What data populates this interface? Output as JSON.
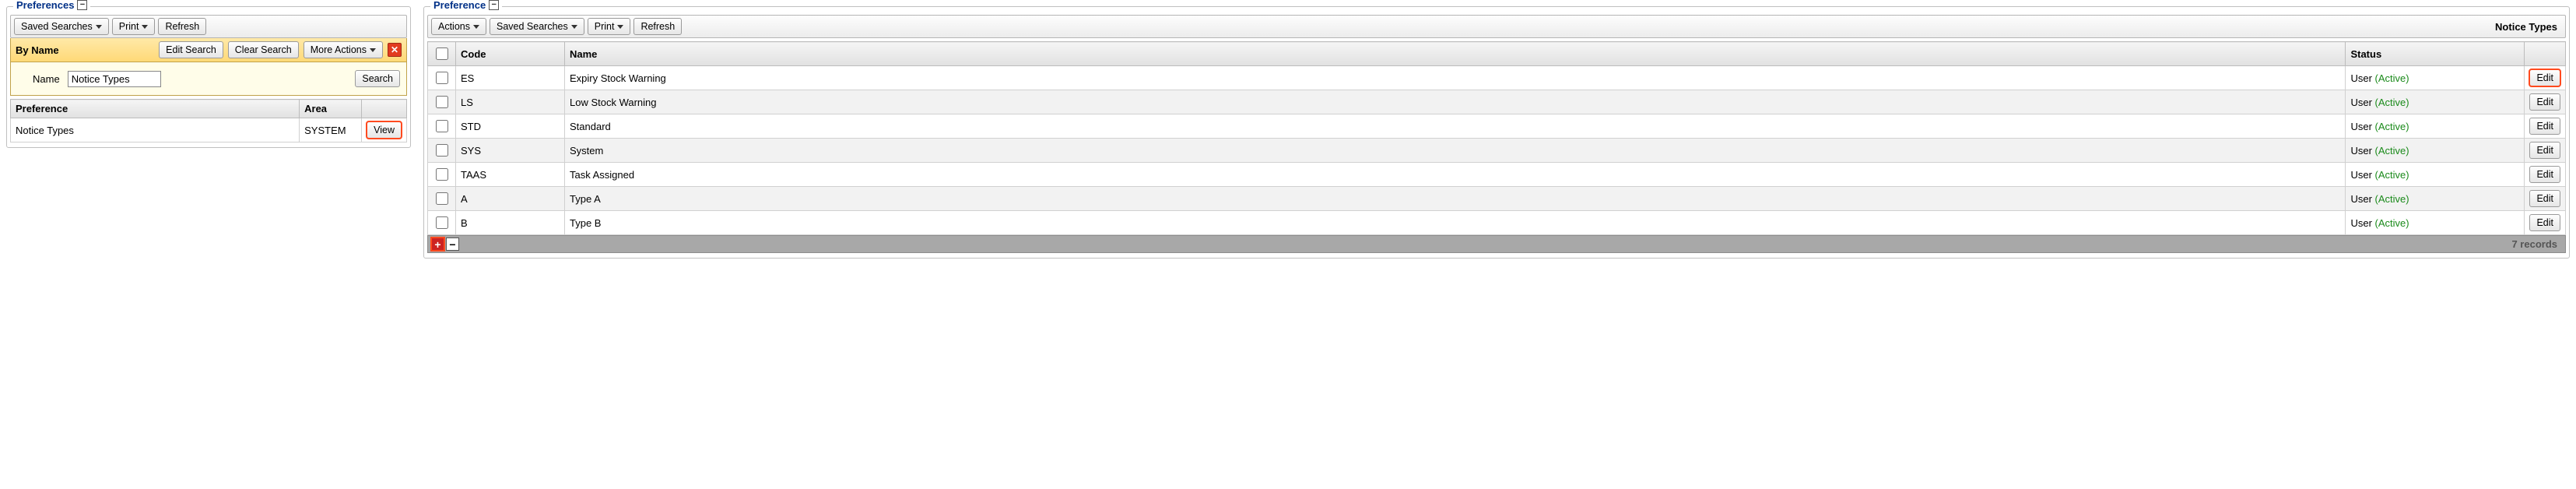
{
  "left": {
    "legend": "Preferences",
    "toolbar": {
      "saved_searches": "Saved Searches",
      "print": "Print",
      "refresh": "Refresh"
    },
    "byname": {
      "label": "By Name",
      "edit_search": "Edit Search",
      "clear_search": "Clear Search",
      "more_actions": "More Actions"
    },
    "search": {
      "name_label": "Name",
      "name_value": "Notice Types",
      "search_btn": "Search"
    },
    "grid": {
      "headers": {
        "preference": "Preference",
        "area": "Area"
      },
      "rows": [
        {
          "preference": "Notice Types",
          "area": "SYSTEM",
          "view": "View"
        }
      ]
    }
  },
  "right": {
    "legend": "Preference",
    "toolbar": {
      "actions": "Actions",
      "saved_searches": "Saved Searches",
      "print": "Print",
      "refresh": "Refresh",
      "title_right": "Notice Types"
    },
    "grid": {
      "headers": {
        "code": "Code",
        "name": "Name",
        "status": "Status"
      },
      "status_user": "User",
      "status_active": "(Active)",
      "edit_label": "Edit",
      "rows": [
        {
          "code": "ES",
          "name": "Expiry Stock Warning"
        },
        {
          "code": "LS",
          "name": "Low Stock Warning"
        },
        {
          "code": "STD",
          "name": "Standard"
        },
        {
          "code": "SYS",
          "name": "System"
        },
        {
          "code": "TAAS",
          "name": "Task Assigned"
        },
        {
          "code": "A",
          "name": "Type A"
        },
        {
          "code": "B",
          "name": "Type B"
        }
      ],
      "footer_records": "7 records"
    }
  }
}
